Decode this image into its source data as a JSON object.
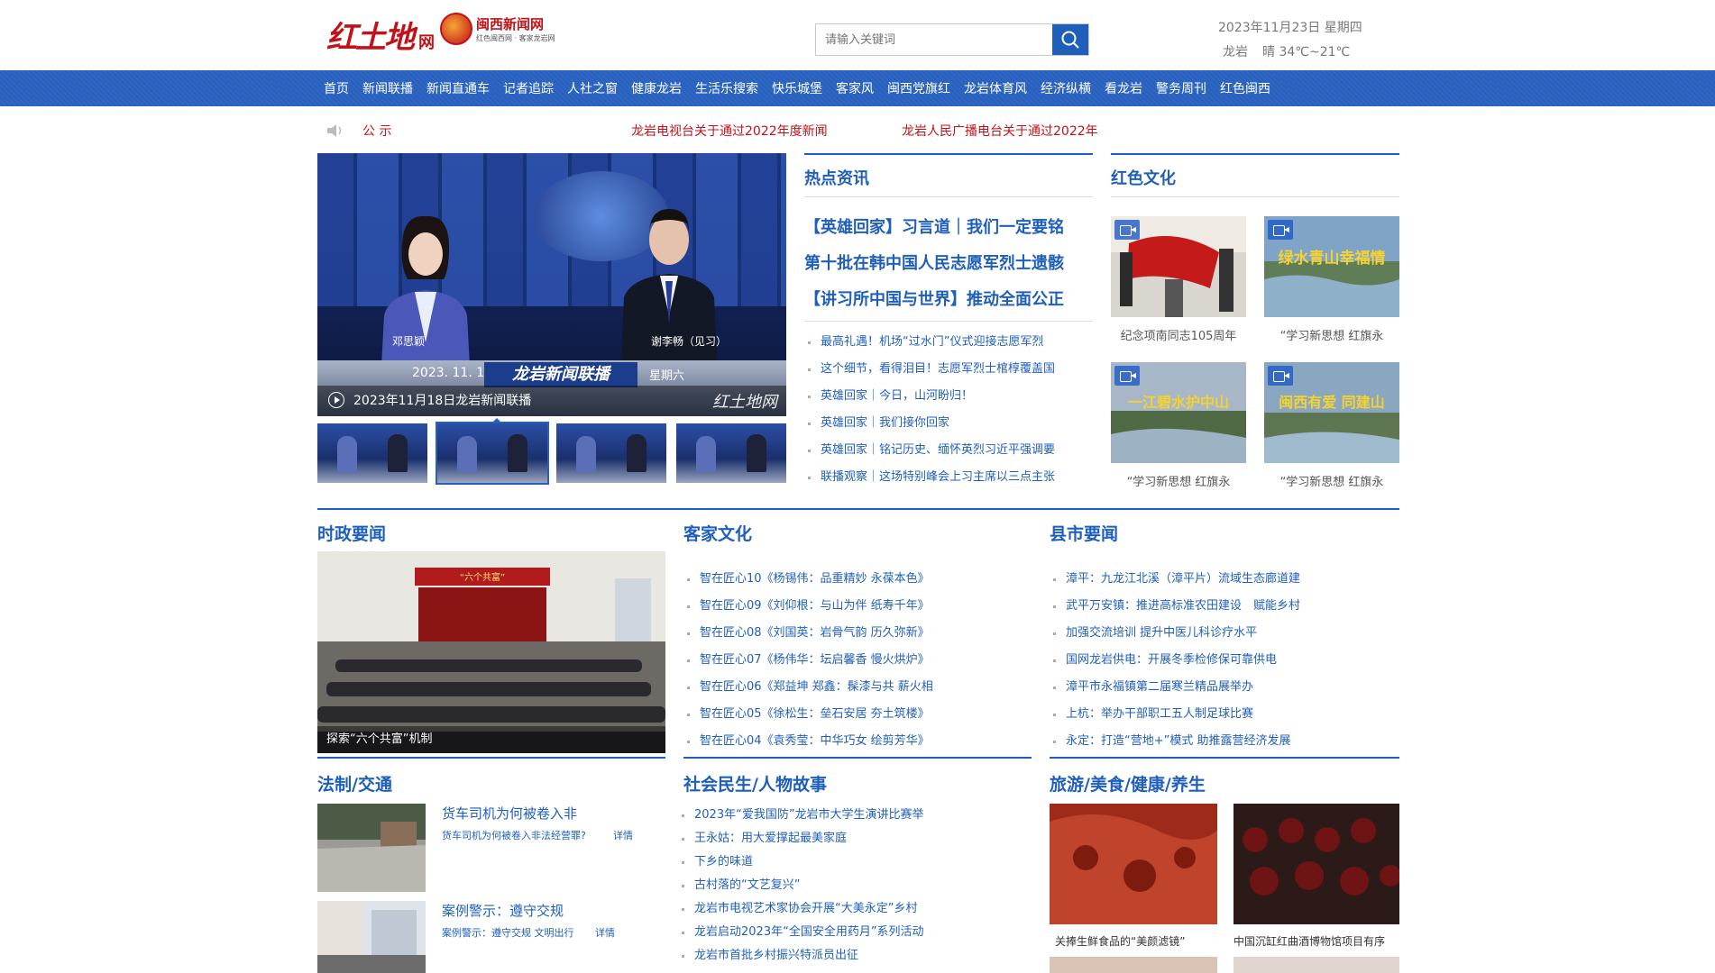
{
  "header": {
    "logo_main": "红土地",
    "logo_main_suffix": "网",
    "logo_second_title": "闽西新闻网",
    "logo_second_sub": "红色闽西网 · 客家龙岩网",
    "search_placeholder": "请输入关键词",
    "date": "2023年11月23日 星期四",
    "city": "龙岩",
    "weather": "晴 34℃~21℃"
  },
  "nav": [
    "首页",
    "新闻联播",
    "新闻直通车",
    "记者追踪",
    "人社之窗",
    "健康龙岩",
    "生活乐搜索",
    "快乐城堡",
    "客家风",
    "闽西党旗红",
    "龙岩体育风",
    "经济纵横",
    "看龙岩",
    "警务周刊",
    "红色闽西"
  ],
  "notice": {
    "label": "公 示",
    "item1": "龙岩电视台关于通过2022年度新闻",
    "item2": "龙岩人民广播电台关于通过2022年"
  },
  "video": {
    "caption": "2023年11月18日龙岩新闻联播",
    "program": "龙岩新闻联播",
    "date": "2023. 11. 18",
    "weekday": "星期六",
    "anchor1": "邓思颖",
    "anchor2": "谢李畅（见习）",
    "watermark": "红土地网"
  },
  "hot": {
    "title": "热点资讯",
    "headlines": [
      "【英雄回家】习言道｜我们一定要铭",
      "第十批在韩中国人民志愿军烈士遗骸",
      "【讲习所中国与世界】推动全面公正"
    ],
    "items": [
      "最高礼遇！机场“过水门”仪式迎接志愿军烈",
      "这个细节，看得泪目！志愿军烈士棺椁覆盖国",
      "英雄回家｜今日，山河盼归！",
      "英雄回家｜我们接你回家",
      "英雄回家｜铭记历史、缅怀英烈习近平强调要",
      "联播观察｜这场特别峰会上习主席以三点主张"
    ]
  },
  "red_culture": {
    "title": "红色文化",
    "captions": [
      "纪念项南同志105周年",
      "“学习新思想 红旗永",
      "“学习新思想 红旗永",
      "“学习新思想 红旗永"
    ],
    "overlay_texts": [
      "绿水青山幸福情",
      "一江碧水护中山",
      "闽西有爱 同建山"
    ]
  },
  "politics": {
    "title": "时政要闻",
    "photo_caption": "探索“六个共富”机制",
    "banner": "“六个共富”"
  },
  "hakka": {
    "title": "客家文化",
    "items": [
      "智在匠心10《杨锡伟：品重精妙 永葆本色》",
      "智在匠心09《刘仰根：与山为伴 纸寿千年》",
      "智在匠心08《刘国英：岩骨气韵 历久弥新》",
      "智在匠心07《杨伟华：坛启馨香 慢火烘炉》",
      "智在匠心06《郑益坤 郑鑫：髹漆与共 薪火相",
      "智在匠心05《徐松生：垒石安居 夯土筑楼》",
      "智在匠心04《袁秀莹：中华巧女 绘剪芳华》"
    ]
  },
  "county": {
    "title": "县市要闻",
    "items": [
      "漳平：九龙江北溪（漳平片）流域生态廊道建",
      "武平万安镇：推进高标准农田建设　赋能乡村",
      "加强交流培训 提升中医儿科诊疗水平",
      "国网龙岩供电：开展冬季检修保可靠供电",
      "漳平市永福镇第二届寒兰精品展举办",
      "上杭：举办干部职工五人制足球比赛",
      "永定：打造“营地+”模式 助推露营经济发展"
    ]
  },
  "law": {
    "title": "法制/交通",
    "entries": [
      {
        "title": "货车司机为何被卷入非",
        "summary": "货车司机为何被卷入非法经营罪?",
        "more": "详情"
      },
      {
        "title": "案例警示：遵守交规",
        "summary": "案例警示：遵守交规 文明出行",
        "more": "详情"
      }
    ]
  },
  "society": {
    "title": "社会民生/人物故事",
    "items": [
      "2023年“爱我国防”龙岩市大学生演讲比赛举",
      "王永姑：用大爱撑起最美家庭",
      "下乡的味道",
      "古村落的“文艺复兴”",
      "龙岩市电视艺术家协会开展“大美永定”乡村",
      "龙岩启动2023年“全国安全用药月”系列活动",
      "龙岩市首批乡村振兴特派员出征"
    ]
  },
  "travel": {
    "title": "旅游/美食/健康/养生",
    "captions": [
      "关捧生鲜食品的“美颜滤镜”",
      "中国沉缸红曲酒博物馆项目有序"
    ]
  },
  "colors": {
    "brand_blue": "#1f5fbc",
    "nav_blue": "#2a60bb",
    "red": "#c1121a"
  }
}
